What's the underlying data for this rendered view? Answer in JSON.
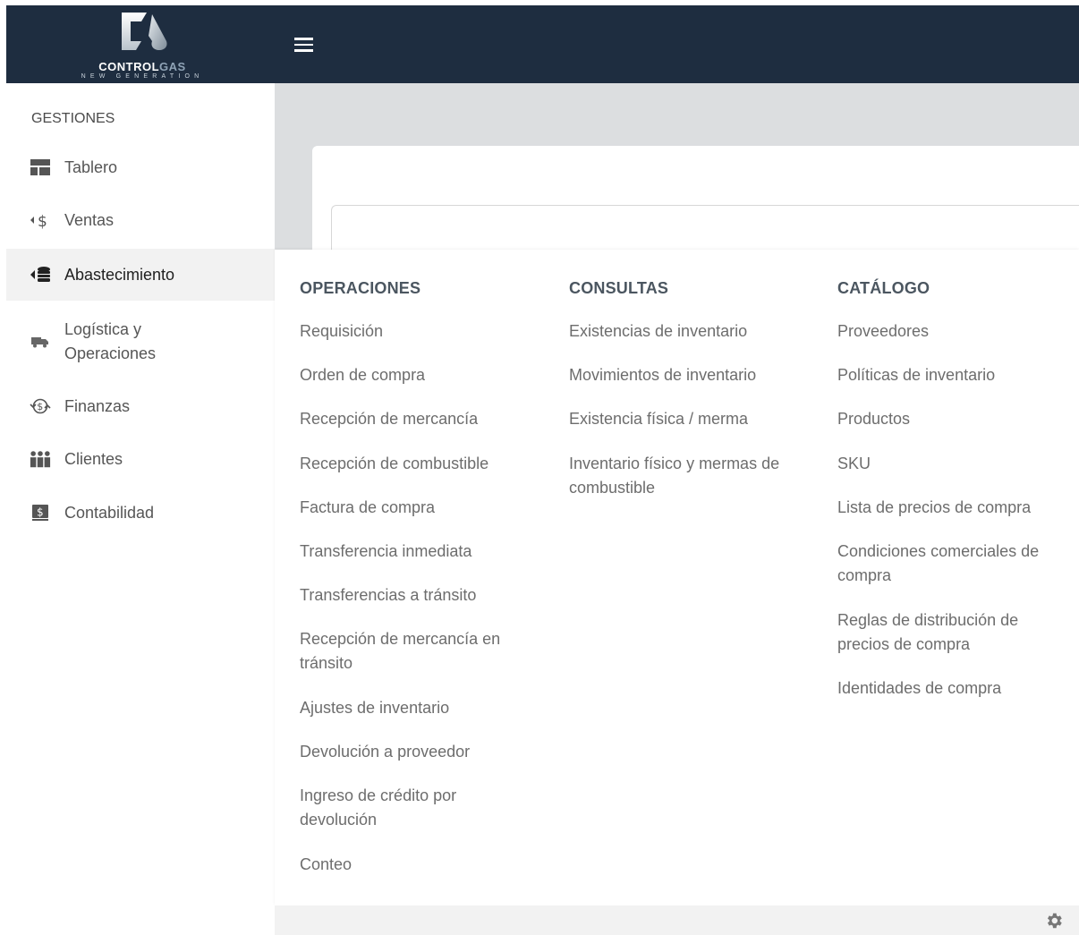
{
  "brand": {
    "name_part1": "CONTROL",
    "name_part2": "GAS",
    "tagline": "NEW GENERATION"
  },
  "sidebar": {
    "heading": "GESTIONES",
    "items": [
      {
        "label": "Tablero",
        "icon": "dashboard-icon"
      },
      {
        "label": "Ventas",
        "icon": "sales-dollar-icon"
      },
      {
        "label": "Abastecimiento",
        "icon": "supply-database-icon",
        "active": true
      },
      {
        "label": "Logística y Operaciones",
        "icon": "truck-icon"
      },
      {
        "label": "Finanzas",
        "icon": "finance-exchange-icon"
      },
      {
        "label": "Clientes",
        "icon": "customers-icon"
      },
      {
        "label": "Contabilidad",
        "icon": "accounting-icon"
      }
    ]
  },
  "menu": {
    "operaciones": {
      "title": "OPERACIONES",
      "items": [
        "Requisición",
        "Orden de compra",
        "Recepción de mercancía",
        "Recepción de combustible",
        "Factura de compra",
        "Transferencia inmediata",
        "Transferencias a tránsito",
        "Recepción de mercancía en tránsito",
        "Ajustes de inventario",
        "Devolución a proveedor",
        "Ingreso de crédito por devolución",
        "Conteo"
      ]
    },
    "consultas": {
      "title": "CONSULTAS",
      "items": [
        "Existencias de inventario",
        "Movimientos de inventario",
        "Existencia física / merma",
        "Inventario físico y mermas de combustible"
      ]
    },
    "catalogo": {
      "title": "CATÁLOGO",
      "items": [
        "Proveedores",
        "Políticas de inventario",
        "Productos",
        "SKU",
        "Lista de precios de compra",
        "Condiciones comerciales de compra",
        "Reglas de distribución de precios de compra",
        "Identidades de compra"
      ]
    }
  },
  "colors": {
    "topbar": "#1e2d40",
    "active_item_bg": "#f2f2f2",
    "content_bg": "#dcdee0"
  }
}
